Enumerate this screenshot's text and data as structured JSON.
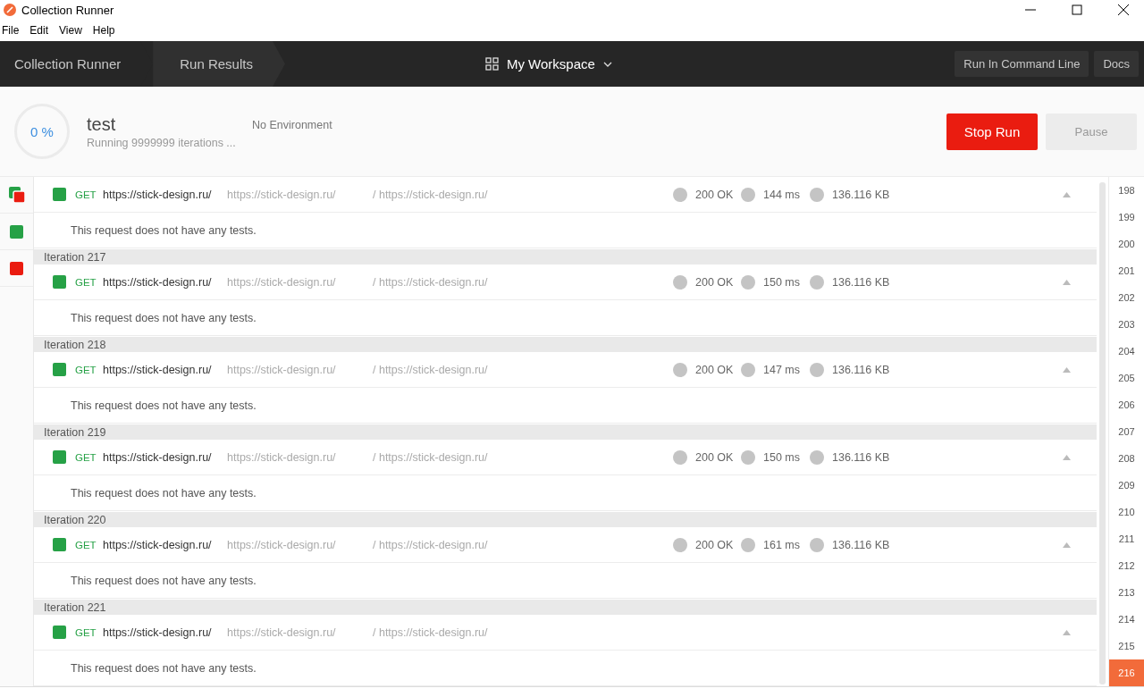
{
  "window": {
    "title": "Collection Runner"
  },
  "menu": [
    "File",
    "Edit",
    "View",
    "Help"
  ],
  "breadcrumbs": [
    {
      "label": "Collection Runner",
      "selected": false
    },
    {
      "label": "Run Results",
      "selected": true
    }
  ],
  "workspace": "My Workspace",
  "header_buttons": [
    "Run In Command Line",
    "Docs"
  ],
  "run": {
    "progress": "0 %",
    "name": "test",
    "status": "Running 9999999 iterations ...",
    "environment": "No Environment"
  },
  "actions": [
    {
      "label": "Stop Run",
      "kind": "primary"
    },
    {
      "label": "Pause",
      "kind": "secondary"
    }
  ],
  "filters": [
    {
      "kind": "all"
    },
    {
      "kind": "passed"
    },
    {
      "kind": "failed"
    }
  ],
  "results": [
    {
      "request": {
        "method": "GET",
        "url": "https://stick-design.ru/",
        "collection": "https://stick-design.ru/",
        "path": "/ https://stick-design.ru/",
        "status": "200 OK",
        "time": "144 ms",
        "size": "136.116 KB"
      },
      "tests_message": "This request does not have any tests."
    },
    {
      "iteration": "Iteration 217",
      "request": {
        "method": "GET",
        "url": "https://stick-design.ru/",
        "collection": "https://stick-design.ru/",
        "path": "/ https://stick-design.ru/",
        "status": "200 OK",
        "time": "150 ms",
        "size": "136.116 KB"
      },
      "tests_message": "This request does not have any tests."
    },
    {
      "iteration": "Iteration 218",
      "request": {
        "method": "GET",
        "url": "https://stick-design.ru/",
        "collection": "https://stick-design.ru/",
        "path": "/ https://stick-design.ru/",
        "status": "200 OK",
        "time": "147 ms",
        "size": "136.116 KB"
      },
      "tests_message": "This request does not have any tests."
    },
    {
      "iteration": "Iteration 219",
      "request": {
        "method": "GET",
        "url": "https://stick-design.ru/",
        "collection": "https://stick-design.ru/",
        "path": "/ https://stick-design.ru/",
        "status": "200 OK",
        "time": "150 ms",
        "size": "136.116 KB"
      },
      "tests_message": "This request does not have any tests."
    },
    {
      "iteration": "Iteration 220",
      "request": {
        "method": "GET",
        "url": "https://stick-design.ru/",
        "collection": "https://stick-design.ru/",
        "path": "/ https://stick-design.ru/",
        "status": "200 OK",
        "time": "161 ms",
        "size": "136.116 KB"
      },
      "tests_message": "This request does not have any tests."
    },
    {
      "iteration": "Iteration 221",
      "request": {
        "method": "GET",
        "url": "https://stick-design.ru/",
        "collection": "https://stick-design.ru/",
        "path": "/ https://stick-design.ru/"
      },
      "tests_message": "This request does not have any tests."
    }
  ],
  "iteration_numbers": [
    {
      "label": "198",
      "selected": false
    },
    {
      "label": "199",
      "selected": false
    },
    {
      "label": "200",
      "selected": false
    },
    {
      "label": "201",
      "selected": false
    },
    {
      "label": "202",
      "selected": false
    },
    {
      "label": "203",
      "selected": false
    },
    {
      "label": "204",
      "selected": false
    },
    {
      "label": "205",
      "selected": false
    },
    {
      "label": "206",
      "selected": false
    },
    {
      "label": "207",
      "selected": false
    },
    {
      "label": "208",
      "selected": false
    },
    {
      "label": "209",
      "selected": false
    },
    {
      "label": "210",
      "selected": false
    },
    {
      "label": "211",
      "selected": false
    },
    {
      "label": "212",
      "selected": false
    },
    {
      "label": "213",
      "selected": false
    },
    {
      "label": "214",
      "selected": false
    },
    {
      "label": "215",
      "selected": false
    },
    {
      "label": "216",
      "selected": true
    }
  ]
}
